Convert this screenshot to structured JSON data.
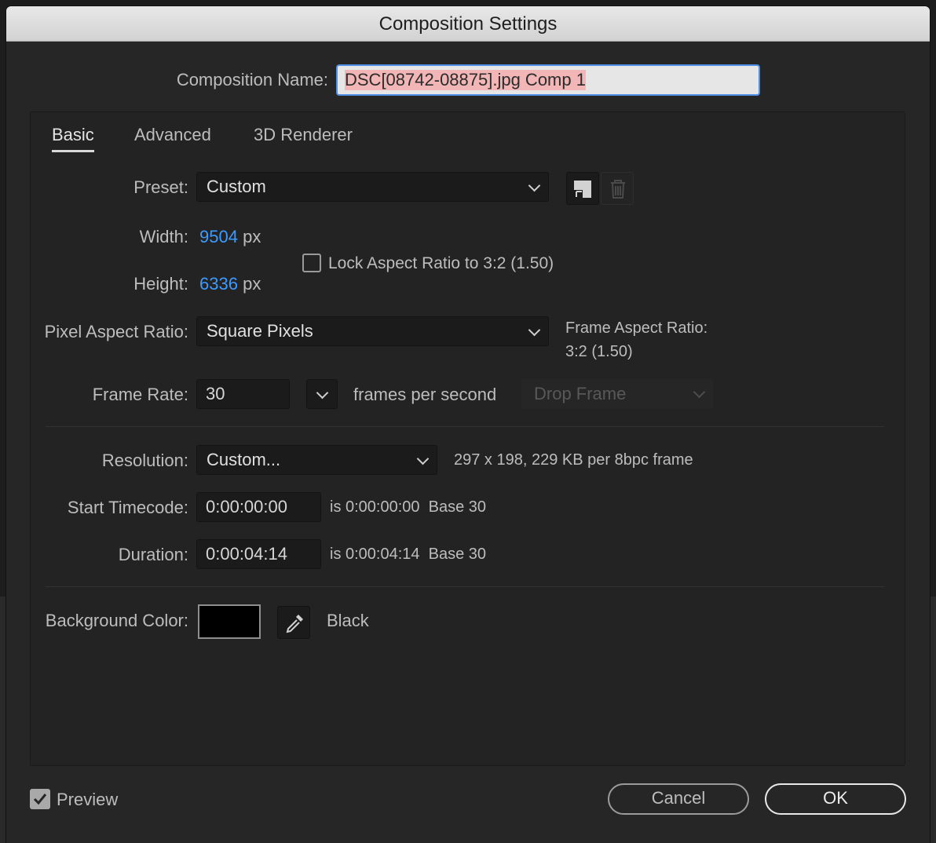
{
  "window": {
    "title": "Composition Settings"
  },
  "name_field": {
    "label": "Composition Name:",
    "value": "DSC[08742-08875].jpg Comp 1"
  },
  "tabs": [
    {
      "label": "Basic"
    },
    {
      "label": "Advanced"
    },
    {
      "label": "3D Renderer"
    }
  ],
  "preset": {
    "label": "Preset:",
    "value": "Custom",
    "save_icon": "save-preset-icon",
    "delete_icon": "trash-icon"
  },
  "size": {
    "width_label": "Width:",
    "width_value": "9504",
    "width_unit": "px",
    "height_label": "Height:",
    "height_value": "6336",
    "height_unit": "px",
    "lock_label": "Lock Aspect Ratio to 3:2 (1.50)",
    "lock_checked": false
  },
  "pixel_aspect": {
    "label": "Pixel Aspect Ratio:",
    "value": "Square Pixels",
    "frame_aspect_label": "Frame Aspect Ratio:",
    "frame_aspect_value": "3:2 (1.50)"
  },
  "frame_rate": {
    "label": "Frame Rate:",
    "value": "30",
    "unit": "frames per second",
    "drop_frame": "Drop Frame"
  },
  "resolution": {
    "label": "Resolution:",
    "value": "Custom...",
    "info": "297 x 198, 229 KB per 8bpc frame"
  },
  "start_timecode": {
    "label": "Start Timecode:",
    "value": "0:00:00:00",
    "is_text": "is 0:00:00:00",
    "base": "Base 30"
  },
  "duration": {
    "label": "Duration:",
    "value": "0:00:04:14",
    "is_text": "is 0:00:04:14",
    "base": "Base 30"
  },
  "background": {
    "label": "Background Color:",
    "swatch_color": "#000000",
    "name": "Black",
    "eyedropper_icon": "eyedropper-icon"
  },
  "footer": {
    "preview_label": "Preview",
    "preview_checked": true,
    "cancel_label": "Cancel",
    "ok_label": "OK"
  },
  "colors": {
    "accent": "#3d9bff",
    "selection": "#f2b6b6"
  }
}
